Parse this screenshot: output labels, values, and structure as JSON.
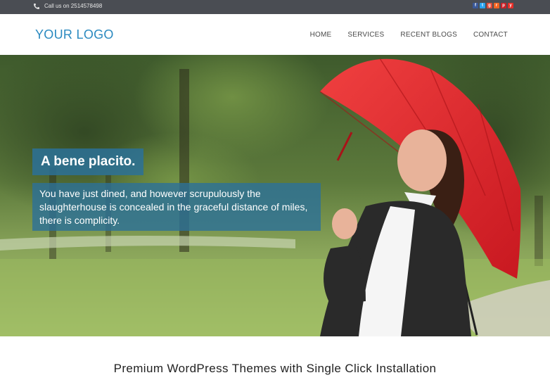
{
  "topbar": {
    "phone_text": "Call us on 2514578498",
    "social_icons": [
      {
        "name": "facebook-icon",
        "color": "#3b5998",
        "glyph": "f"
      },
      {
        "name": "twitter-icon",
        "color": "#2aa3ef",
        "glyph": "t"
      },
      {
        "name": "google-plus-icon",
        "color": "#dd4b39",
        "glyph": "g"
      },
      {
        "name": "rss-icon",
        "color": "#f26522",
        "glyph": "r"
      },
      {
        "name": "pinterest-icon",
        "color": "#cb2027",
        "glyph": "p"
      },
      {
        "name": "youtube-icon",
        "color": "#e52d27",
        "glyph": "y"
      }
    ]
  },
  "header": {
    "logo": "YOUR LOGO",
    "nav": [
      "HOME",
      "SERVICES",
      "RECENT BLOGS",
      "CONTACT"
    ]
  },
  "hero": {
    "title": "A bene placito.",
    "body": "You have just dined, and however scrupulously the slaughterhouse is concealed in the graceful distance of miles, there is complicity."
  },
  "tagline": "Premium WordPress Themes with Single Click Installation",
  "colors": {
    "accent": "#2b8ac0",
    "topbar": "#4a4d53",
    "caption_bg": "#2c7198",
    "umbrella": "#e8262f"
  }
}
